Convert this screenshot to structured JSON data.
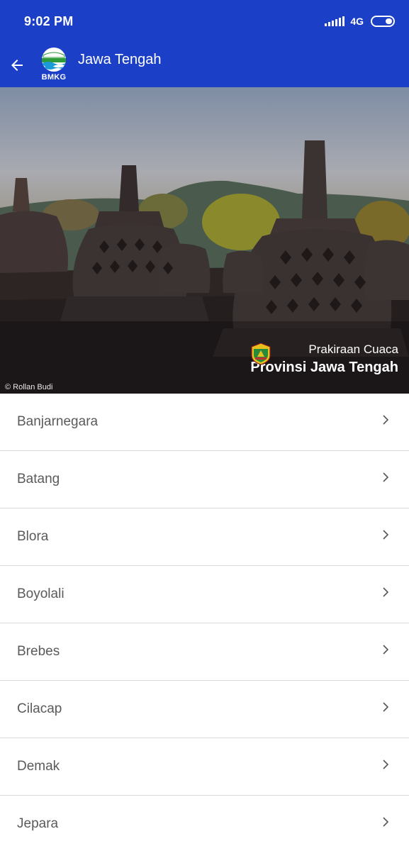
{
  "status_bar": {
    "time": "9:02 PM",
    "network": "4G",
    "icons": [
      "signal-icon",
      "battery-icon"
    ]
  },
  "app_bar": {
    "title": "Jawa Tengah",
    "logo_text": "BMKG",
    "back_icon": "arrow-left-icon"
  },
  "hero": {
    "subtitle": "Prakiraan Cuaca",
    "title": "Provinsi Jawa Tengah",
    "credit": "© Rollan Budi",
    "emblem_icon": "province-emblem-icon"
  },
  "regencies": [
    {
      "label": "Banjarnegara"
    },
    {
      "label": "Batang"
    },
    {
      "label": "Blora"
    },
    {
      "label": "Boyolali"
    },
    {
      "label": "Brebes"
    },
    {
      "label": "Cilacap"
    },
    {
      "label": "Demak"
    },
    {
      "label": "Jepara"
    }
  ],
  "colors": {
    "primary": "#1c3fc8",
    "list_text": "#5a5a5a",
    "divider": "#d9d9d9"
  }
}
